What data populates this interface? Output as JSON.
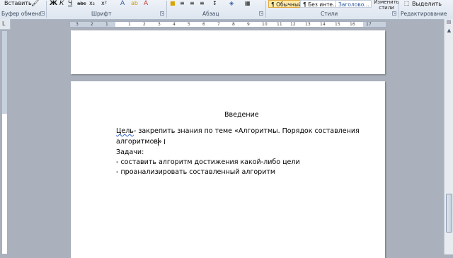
{
  "ribbon": {
    "clipboard": {
      "paste_label": "Вставить",
      "group_label": "Буфер обмена"
    },
    "font": {
      "group_label": "Шрифт",
      "bold": "Ж",
      "italic": "К",
      "underline": "Ч",
      "strike": "abc",
      "sub": "x₂",
      "sup": "x²"
    },
    "paragraph": {
      "group_label": "Абзац"
    },
    "styles": {
      "normal": "¶ Обычный",
      "no_spacing": "¶ Без инте...",
      "heading": "Заголово...",
      "change_styles": "Изменить стили",
      "group_label": "Стили"
    },
    "editing": {
      "select_label": "Выделить",
      "group_label": "Редактирование"
    }
  },
  "ruler": {
    "corner": "L",
    "numbers": [
      "3",
      "2",
      "1",
      "1",
      "2",
      "3",
      "4",
      "5",
      "6",
      "7",
      "8",
      "9",
      "10",
      "11",
      "12",
      "13",
      "14",
      "15",
      "16",
      "17"
    ]
  },
  "document": {
    "heading": "Введение",
    "goal_word": "Цель",
    "goal_rest": "- закрепить знания по теме «Алгоритмы. Порядок составления",
    "goal_line2": "алгоритмов»",
    "tasks_label": "Задачи:",
    "task1": "- составить алгоритм достижения какой-либо цели",
    "task2": "- проанализировать составленный алгоритм"
  },
  "colors": {
    "accent": "#2b579a",
    "squiggle": "#2f64d8",
    "background": "#aab1bc"
  }
}
